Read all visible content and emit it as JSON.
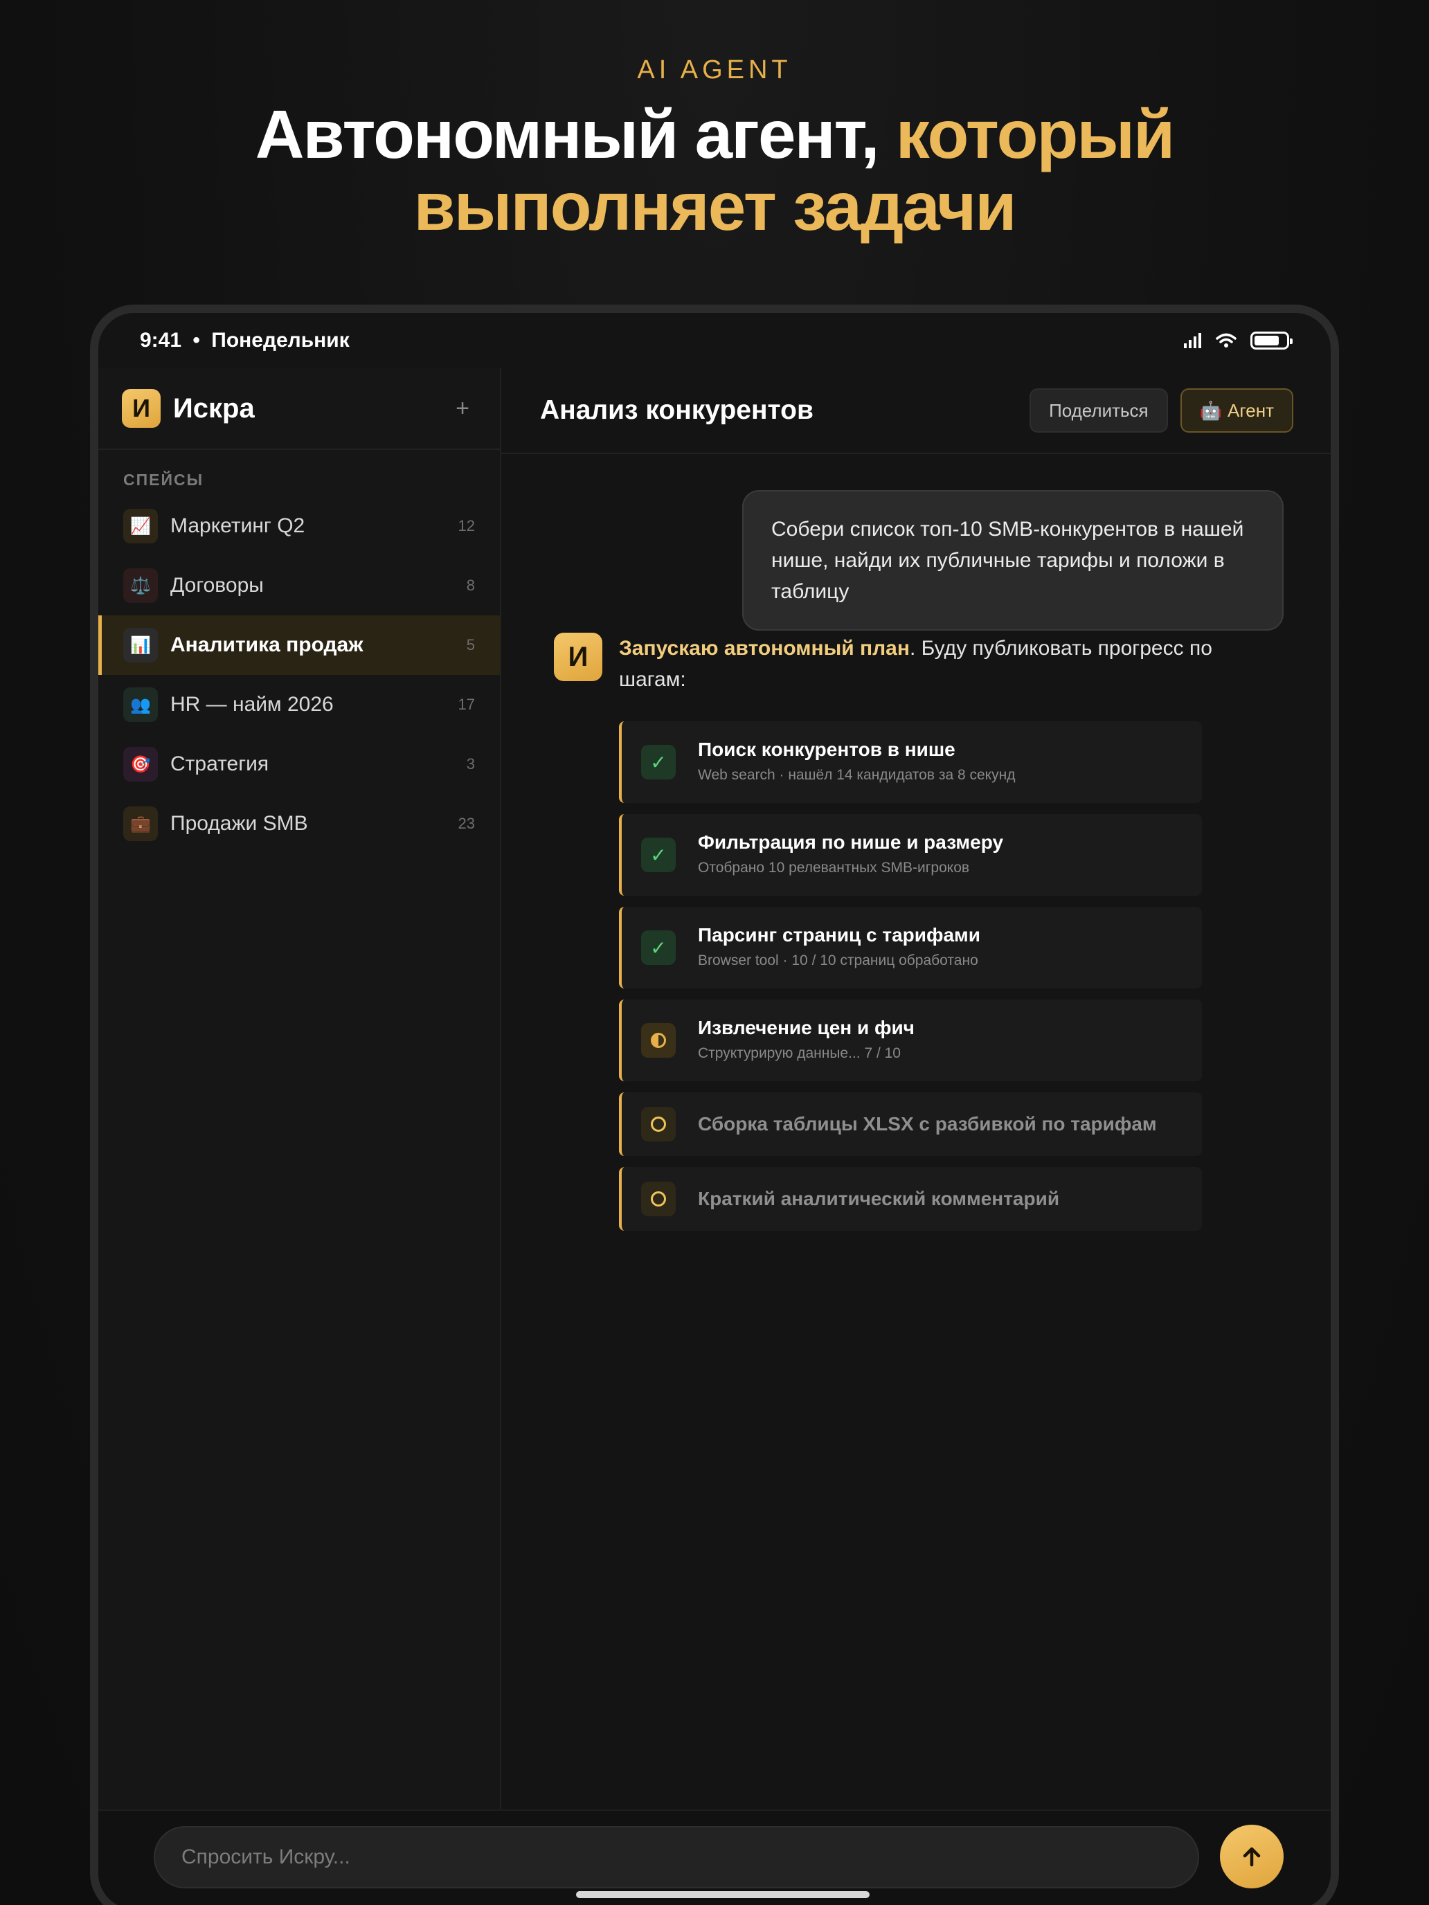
{
  "hero": {
    "eyebrow": "AI AGENT",
    "title_white": "Автономный агент,",
    "title_gold_1": "который",
    "title_gold_2": "выполняет задачи"
  },
  "status": {
    "time": "9:41",
    "separator": "•",
    "day": "Понедельник"
  },
  "sidebar": {
    "logo_letter": "И",
    "brand": "Искра",
    "add": "+",
    "section": "СПЕЙСЫ",
    "items": [
      {
        "icon": "📈",
        "label": "Маркетинг Q2",
        "count": "12",
        "bg": "#2e2718"
      },
      {
        "icon": "⚖️",
        "label": "Договоры",
        "count": "8",
        "bg": "#2d1c1c"
      },
      {
        "icon": "📊",
        "label": "Аналитика продаж",
        "count": "5",
        "bg": "#2c2c2c"
      },
      {
        "icon": "👥",
        "label": "HR — найм 2026",
        "count": "17",
        "bg": "#1e2a24"
      },
      {
        "icon": "🎯",
        "label": "Стратегия",
        "count": "3",
        "bg": "#2a1c2a"
      },
      {
        "icon": "💼",
        "label": "Продажи SMB",
        "count": "23",
        "bg": "#2e2718"
      }
    ]
  },
  "main": {
    "title": "Анализ конкурентов",
    "share_label": "Поделиться",
    "agent_icon": "🤖",
    "agent_label": "Агент",
    "user_message": "Собери список топ-10 SMB-конкурентов в нашей нише, найди их публичные тарифы и положи в таблицу",
    "agent_avatar": "И",
    "agent_highlight": "Запускаю автономный план",
    "agent_text": ". Буду публиковать прогресс по шагам:",
    "steps": [
      {
        "status": "done",
        "icon": "✓",
        "title": "Поиск конкурентов в нише",
        "sub": "Web search · нашёл 14 кандидатов за 8 секунд"
      },
      {
        "status": "done",
        "icon": "✓",
        "title": "Фильтрация по нише и размеру",
        "sub": "Отобрано 10 релевантных SMB-игроков"
      },
      {
        "status": "done",
        "icon": "✓",
        "title": "Парсинг страниц с тарифами",
        "sub": "Browser tool · 10 / 10 страниц обработано"
      },
      {
        "status": "progress",
        "icon": "◐",
        "title": "Извлечение цен и фич",
        "sub": "Структурирую данные... 7 / 10"
      },
      {
        "status": "pending",
        "icon": "○",
        "title": "Сборка таблицы XLSX с разбивкой по тарифам",
        "sub": ""
      },
      {
        "status": "pending",
        "icon": "○",
        "title": "Краткий аналитический комментарий",
        "sub": ""
      }
    ]
  },
  "footer": {
    "placeholder": "Спросить Искру...",
    "send_icon": "arrow-up-icon"
  },
  "colors": {
    "accent": "#e8b04a",
    "done": "#5ed37a",
    "background": "#111111"
  }
}
